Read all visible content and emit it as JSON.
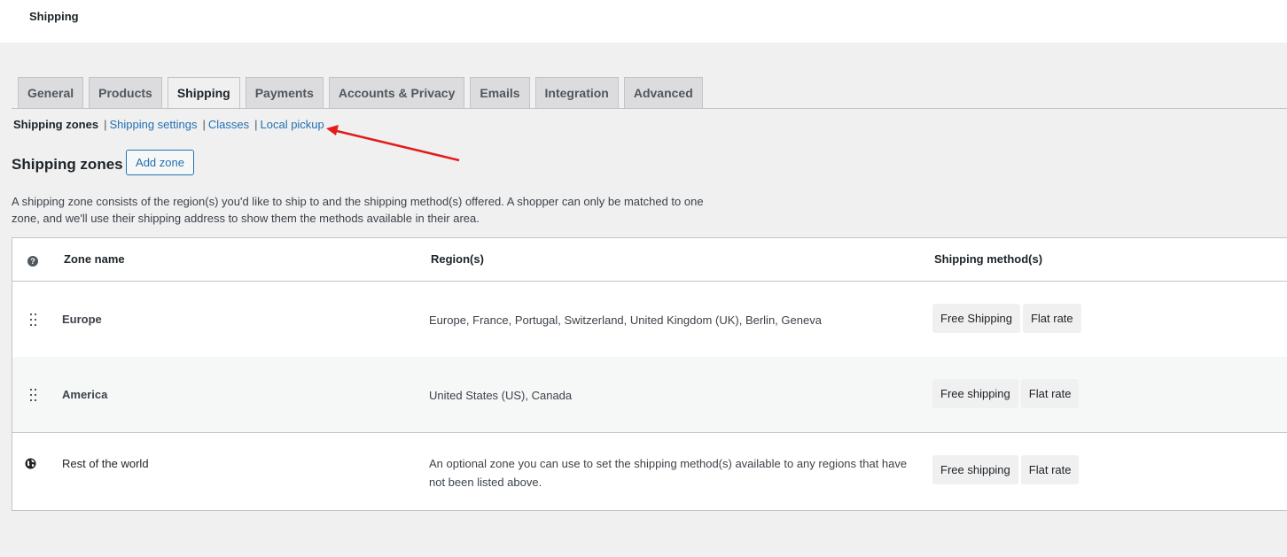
{
  "page": {
    "title": "Shipping"
  },
  "tabs": [
    {
      "label": "General",
      "active": false
    },
    {
      "label": "Products",
      "active": false
    },
    {
      "label": "Shipping",
      "active": true
    },
    {
      "label": "Payments",
      "active": false
    },
    {
      "label": "Accounts & Privacy",
      "active": false
    },
    {
      "label": "Emails",
      "active": false
    },
    {
      "label": "Integration",
      "active": false
    },
    {
      "label": "Advanced",
      "active": false
    }
  ],
  "subnav": {
    "current": "Shipping zones",
    "separator": "|",
    "links": [
      "Shipping settings",
      "Classes",
      "Local pickup"
    ]
  },
  "section": {
    "heading": "Shipping zones",
    "add_button": "Add zone",
    "description": "A shipping zone consists of the region(s) you'd like to ship to and the shipping method(s) offered. A shopper can only be matched to one zone, and we'll use their shipping address to show them the methods available in their area."
  },
  "table": {
    "help_icon": "?",
    "headers": {
      "zone": "Zone name",
      "regions": "Region(s)",
      "methods": "Shipping method(s)"
    },
    "rows": [
      {
        "name": "Europe",
        "regions": "Europe, France, Portugal, Switzerland, United Kingdom (UK), Berlin, Geneva",
        "methods": [
          "Free Shipping",
          "Flat rate"
        ],
        "icon": "drag-handle-icon"
      },
      {
        "name": "America",
        "regions": "United States (US), Canada",
        "methods": [
          "Free shipping",
          "Flat rate"
        ],
        "icon": "drag-handle-icon"
      },
      {
        "name": "Rest of the world",
        "regions": "An optional zone you can use to set the shipping method(s) available to any regions that have not been listed above.",
        "methods": [
          "Free shipping",
          "Flat rate"
        ],
        "icon": "globe-icon"
      }
    ]
  },
  "colors": {
    "link": "#2271b1",
    "annotation_arrow": "#e31b1b",
    "background": "#f0f0f1"
  }
}
